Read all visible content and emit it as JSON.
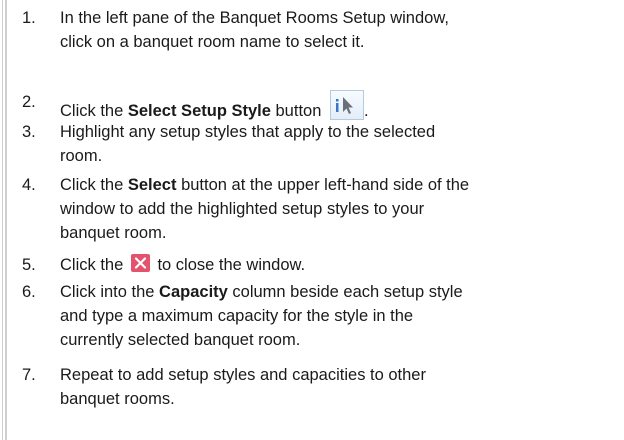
{
  "steps": [
    {
      "number": "1.",
      "lines": [
        "In the left pane of the Banquet Rooms Setup window,",
        "click on a banquet room name to select it."
      ]
    },
    {
      "number": "2.",
      "pre": "Click the ",
      "bold": "Select Setup Style",
      "post": " button",
      "end": ".",
      "icon": "select-setup-style-icon"
    },
    {
      "number": "3.",
      "lines": [
        "Highlight any setup styles that apply to the selected",
        "room."
      ]
    },
    {
      "number": "4.",
      "pre": "Click the ",
      "bold": "Select",
      "post": " button at the upper left-hand side of the",
      "lines": [
        "window to add the highlighted setup styles to your",
        "banquet room."
      ]
    },
    {
      "number": "5.",
      "pre": "Click the ",
      "post": " to close the window.",
      "icon": "close-icon"
    },
    {
      "number": "6.",
      "pre": "Click into the ",
      "bold": "Capacity",
      "post": " column beside each setup style",
      "lines": [
        "and type a maximum capacity for the style in the",
        "currently selected banquet room."
      ]
    },
    {
      "number": "7.",
      "lines": [
        "Repeat to add setup styles and capacities to other",
        "banquet rooms."
      ]
    }
  ]
}
